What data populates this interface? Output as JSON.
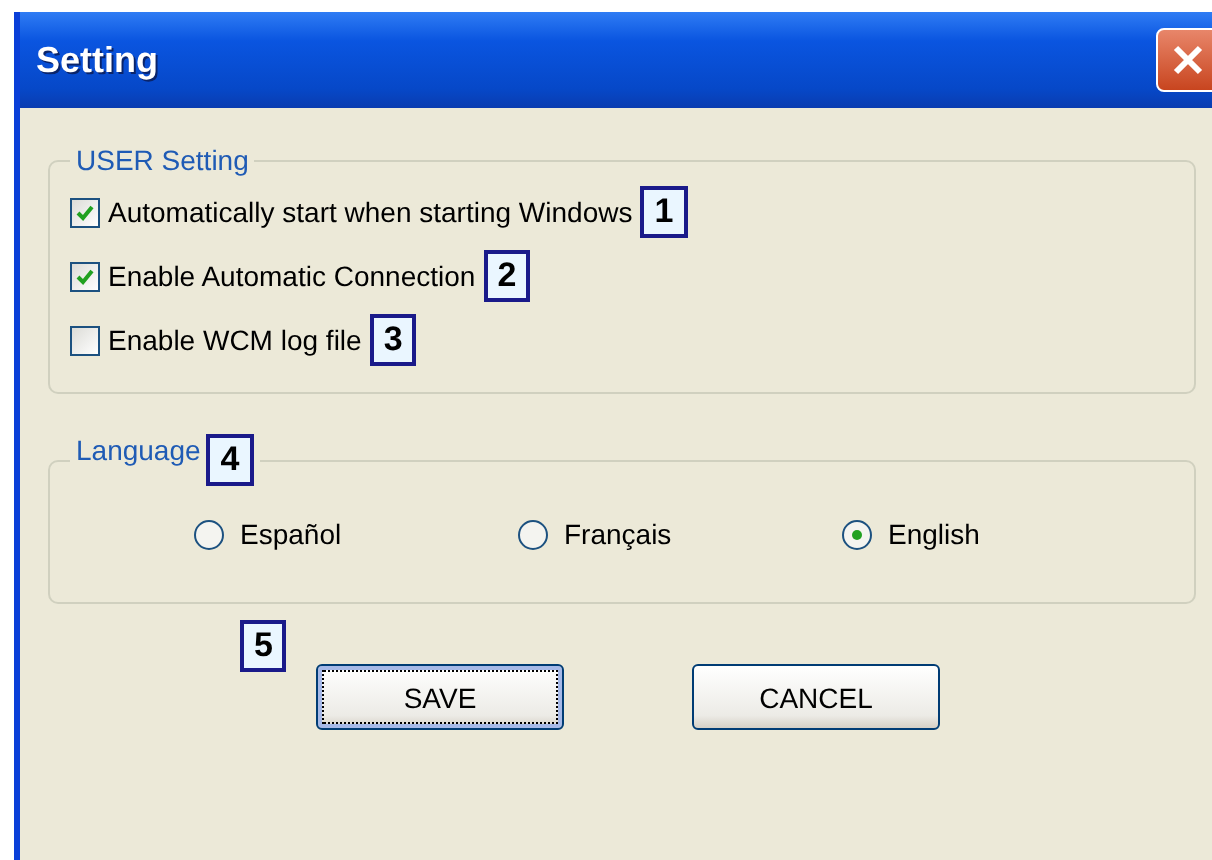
{
  "window": {
    "title": "Setting"
  },
  "user_setting": {
    "legend": "USER Setting",
    "options": [
      {
        "label": "Automatically start when starting Windows",
        "checked": true,
        "callout": "1"
      },
      {
        "label": "Enable Automatic Connection",
        "checked": true,
        "callout": "2"
      },
      {
        "label": "Enable WCM log file",
        "checked": false,
        "callout": "3"
      }
    ]
  },
  "language": {
    "legend": "Language",
    "callout": "4",
    "options": [
      {
        "label": "Español",
        "selected": false
      },
      {
        "label": "Français",
        "selected": false
      },
      {
        "label": "English",
        "selected": true
      }
    ]
  },
  "buttons": [
    {
      "label": "SAVE",
      "focused": true,
      "callout": "5"
    },
    {
      "label": "CANCEL",
      "focused": false
    }
  ]
}
